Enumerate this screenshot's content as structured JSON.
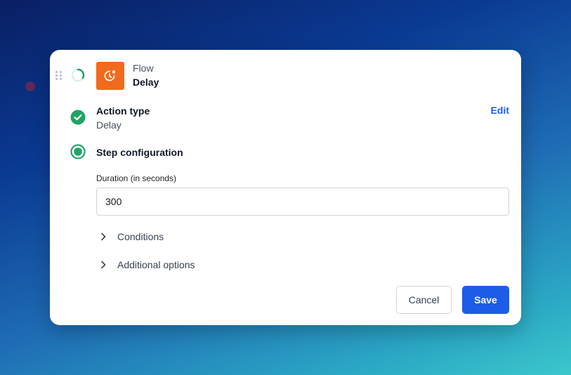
{
  "step": {
    "app_name": "Flow",
    "app_action": "Delay",
    "app_color": "#f26a1b",
    "status_icon": "loading-spinner-icon",
    "app_icon": "timer-clock-icon"
  },
  "action_type": {
    "title": "Action type",
    "value": "Delay",
    "edit_label": "Edit",
    "status_icon": "check-circle-icon"
  },
  "step_configuration": {
    "title": "Step configuration",
    "status_icon": "active-radio-icon",
    "duration": {
      "label": "Duration (in seconds)",
      "value": "300"
    },
    "sections": [
      {
        "label": "Conditions"
      },
      {
        "label": "Additional options"
      }
    ]
  },
  "actions": {
    "cancel_label": "Cancel",
    "save_label": "Save"
  },
  "colors": {
    "accent": "#1d5ce6",
    "success": "#1fa463",
    "brand_orange": "#f26a1b"
  }
}
